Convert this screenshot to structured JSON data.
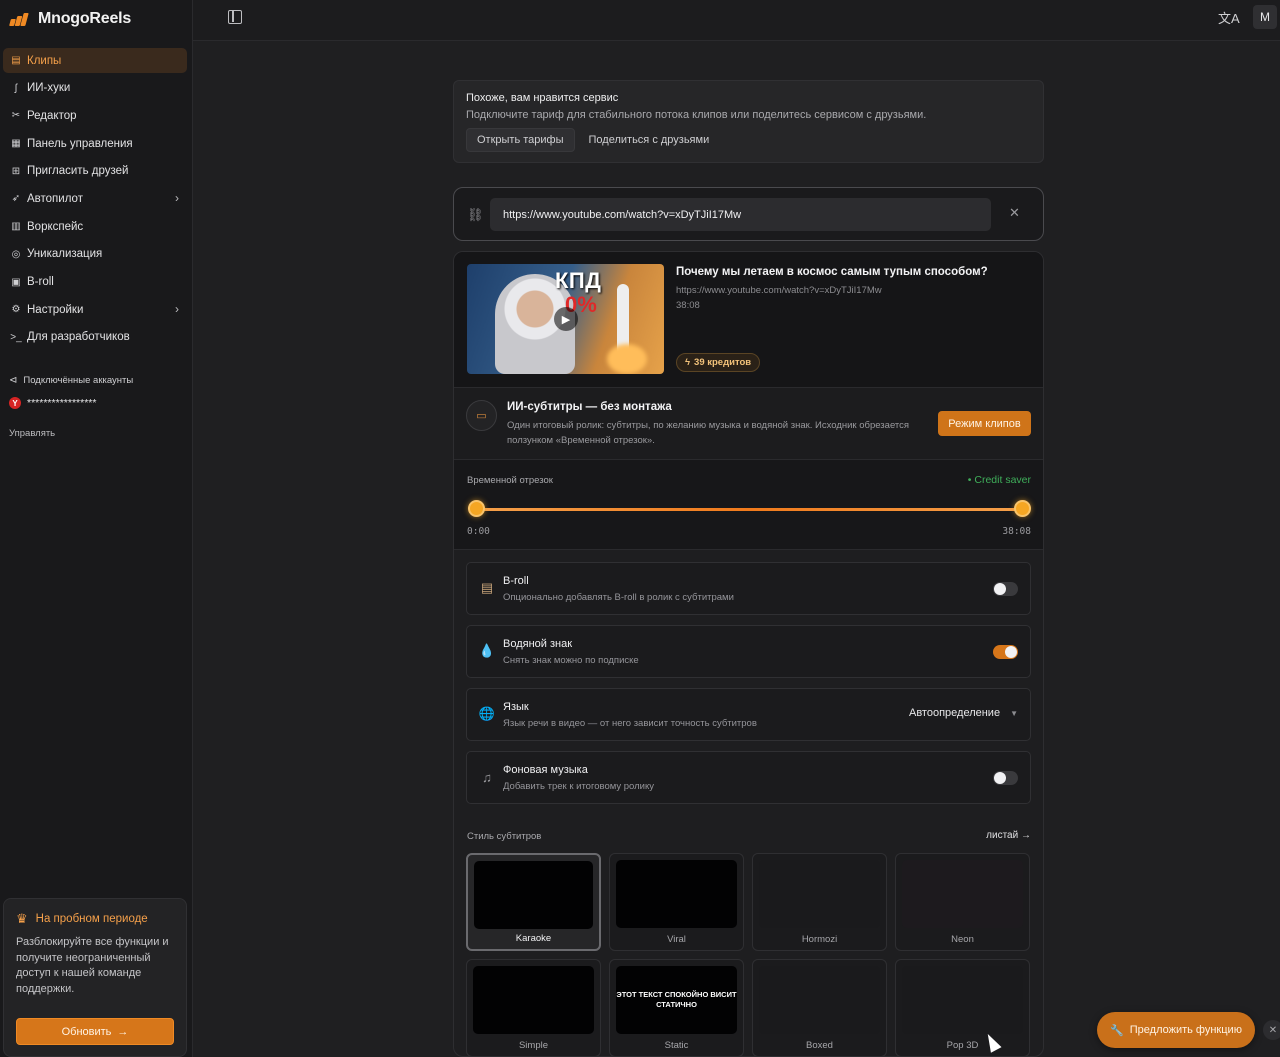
{
  "app": {
    "name": "MnogoReels"
  },
  "sidebar": {
    "items": [
      {
        "label": "Клипы",
        "icon": "clapperboard-icon",
        "active": true
      },
      {
        "label": "ИИ-хуки",
        "icon": "hook-icon"
      },
      {
        "label": "Редактор",
        "icon": "scissors-icon"
      },
      {
        "label": "Панель управления",
        "icon": "dashboard-icon"
      },
      {
        "label": "Пригласить друзей",
        "icon": "gift-icon"
      },
      {
        "label": "Автопилот",
        "icon": "rocket-icon",
        "has_submenu": true
      },
      {
        "label": "Воркспейс",
        "icon": "building-icon"
      },
      {
        "label": "Уникализация",
        "icon": "fingerprint-icon"
      },
      {
        "label": "B-roll",
        "icon": "film-icon"
      },
      {
        "label": "Настройки",
        "icon": "gear-icon",
        "has_submenu": true
      },
      {
        "label": "Для разработчиков",
        "icon": "terminal-icon"
      }
    ],
    "connected_label": "Подключённые аккаунты",
    "account_masked": "*****************",
    "manage_label": "Управлять",
    "trial": {
      "title": "На пробном периоде",
      "text": "Разблокируйте все функции и получите неограниченный доступ к нашей команде поддержки.",
      "button": "Обновить"
    }
  },
  "topbar": {
    "avatar_letter": "M"
  },
  "promo": {
    "title": "Похоже, вам нравится сервис",
    "subtitle": "Подключите тариф для стабильного потока клипов или поделитесь сервисом с друзьями.",
    "open_plans": "Открыть тарифы",
    "share": "Поделиться с друзьями"
  },
  "url_input": {
    "value": "https://www.youtube.com/watch?v=xDyTJiI17Mw"
  },
  "video": {
    "title": "Почему мы летаем в космос самым тупым способом?",
    "url": "https://www.youtube.com/watch?v=xDyTJiI17Mw",
    "duration": "38:08",
    "credits": "39 кредитов",
    "thumb_text": "КПД",
    "thumb_pct": "0%"
  },
  "subtitles_mode": {
    "title": "ИИ-субтитры — без монтажа",
    "desc": "Один итоговый ролик: субтитры, по желанию музыка и водяной знак. Исходник обрезается ползунком «Временной отрезок».",
    "button": "Режим клипов"
  },
  "time_range": {
    "label": "Временной отрезок",
    "badge": "• Credit saver",
    "start": "0:00",
    "end": "38:08",
    "start_fraction": 0,
    "end_fraction": 1
  },
  "options": [
    {
      "title": "B-roll",
      "sub": "Опционально добавлять B-roll в ролик с субтитрами",
      "type": "toggle",
      "on": false,
      "icon": "film-icon"
    },
    {
      "title": "Водяной знак",
      "sub": "Снять знак можно по подписке",
      "type": "toggle",
      "on": true,
      "icon": "droplet-icon"
    },
    {
      "title": "Язык",
      "sub": "Язык речи в видео — от него зависит точность субтитров",
      "type": "select",
      "value": "Автоопределение",
      "icon": "globe-icon"
    },
    {
      "title": "Фоновая музыка",
      "sub": "Добавить трек к итоговому ролику",
      "type": "toggle",
      "on": false,
      "icon": "music-note-icon"
    }
  ],
  "styles": {
    "label": "Стиль субтитров",
    "more": "листай →",
    "tiles": [
      {
        "name": "Karaoke",
        "selected": true,
        "preview_text": ""
      },
      {
        "name": "Viral",
        "preview_text": ""
      },
      {
        "name": "Hormozi",
        "preview_text": ""
      },
      {
        "name": "Neon",
        "preview_text": ""
      },
      {
        "name": "Simple",
        "preview_text": ""
      },
      {
        "name": "Static",
        "preview_text": "ЭТОТ ТЕКСТ СПОКОЙНО ВИСИТ СТАТИЧНО"
      },
      {
        "name": "Boxed",
        "preview_text": ""
      },
      {
        "name": "Pop 3D",
        "preview_text": ""
      }
    ]
  },
  "suggest_button": "Предложить функцию",
  "colors": {
    "accent": "#d6761a",
    "accent_light": "#f5a04a",
    "success": "#3fae5a",
    "bg": "#1f1f21"
  }
}
